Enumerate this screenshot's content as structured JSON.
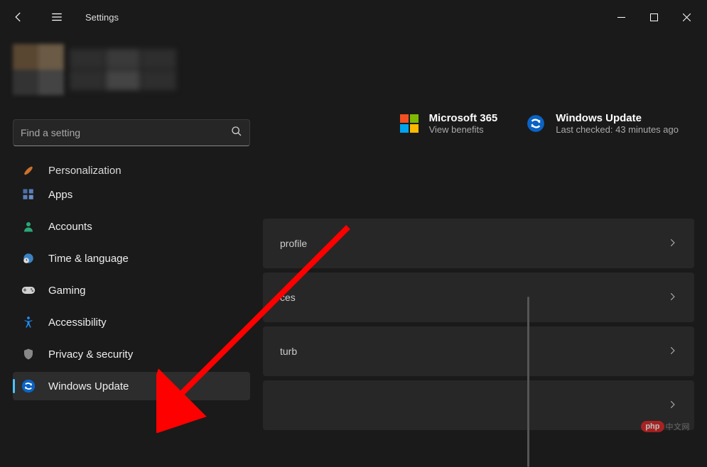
{
  "window": {
    "title": "Settings"
  },
  "search": {
    "placeholder": "Find a setting"
  },
  "sidebar": {
    "items": [
      {
        "label": "Personalization"
      },
      {
        "label": "Apps"
      },
      {
        "label": "Accounts"
      },
      {
        "label": "Time & language"
      },
      {
        "label": "Gaming"
      },
      {
        "label": "Accessibility"
      },
      {
        "label": "Privacy & security"
      },
      {
        "label": "Windows Update"
      }
    ]
  },
  "topcards": {
    "ms365": {
      "title": "Microsoft 365",
      "sub": "View benefits"
    },
    "update": {
      "title": "Windows Update",
      "sub": "Last checked: 43 minutes ago"
    }
  },
  "panels": [
    {
      "label": "profile"
    },
    {
      "label": "ces"
    },
    {
      "label": "turb"
    },
    {
      "label": ""
    }
  ],
  "watermark": {
    "red": "php",
    "gray": "中文网"
  }
}
